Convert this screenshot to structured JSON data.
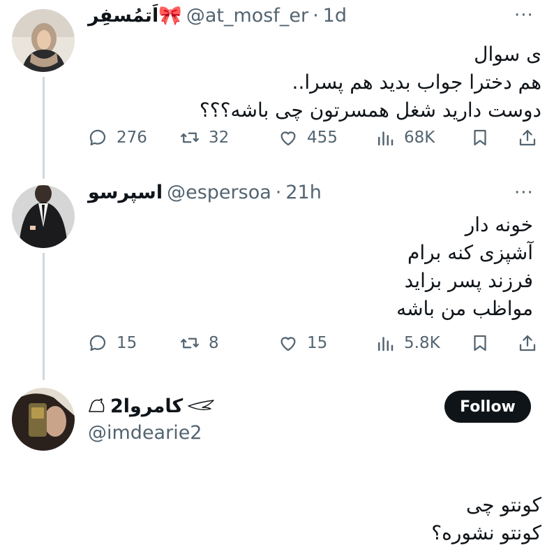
{
  "colors": {
    "text": "#0f1419",
    "secondary": "#536471",
    "thread_line": "#cfd9de",
    "follow_bg": "#0f1419"
  },
  "tweets": [
    {
      "name": "اَتمُسفِر🎀",
      "handle": "@at_mosf_er",
      "sep": "·",
      "time": "1d",
      "more": "···",
      "lines": [
        "ی سوال",
        "هم دخترا جواب بدید هم پسرا..",
        "دوست دارید شغل همسرتون چی باشه؟؟؟"
      ],
      "replies": "276",
      "retweets": "32",
      "likes": "455",
      "views": "68K"
    },
    {
      "name": "اسپرسو",
      "handle": "@espersoa",
      "sep": "·",
      "time": "21h",
      "more": "···",
      "lines": [
        "خونه دار",
        "آشپزی کنه برام",
        "فرزند پسر بزاید",
        "مواظب من باشه"
      ],
      "replies": "15",
      "retweets": "8",
      "likes": "15",
      "views": "5.8K"
    },
    {
      "name": "کامروا2",
      "handle": "@imdearie2",
      "follow_label": "Follow",
      "lines": [
        "کونتو چی",
        "کونتو نشوره؟"
      ]
    }
  ],
  "icons": [
    "reply-icon",
    "retweet-icon",
    "like-icon",
    "views-icon",
    "bookmark-icon",
    "share-icon",
    "more-icon"
  ]
}
